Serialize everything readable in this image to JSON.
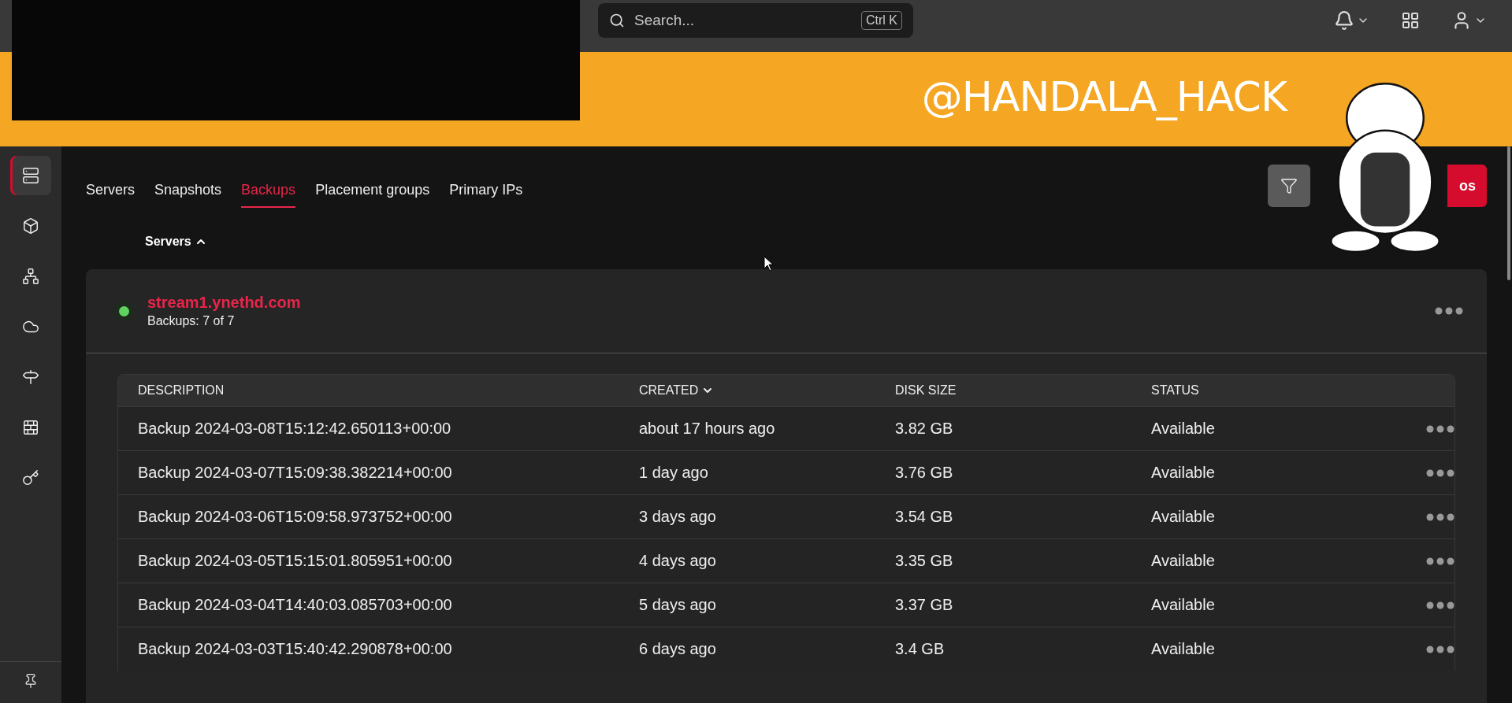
{
  "search": {
    "placeholder": "Search...",
    "shortcut": "Ctrl K"
  },
  "banner": {
    "text": "@HANDALA_HACK"
  },
  "sidebar": {
    "items": [
      {
        "selected": true
      },
      {
        "selected": false
      },
      {
        "selected": false
      },
      {
        "selected": false
      },
      {
        "selected": false
      },
      {
        "selected": false
      },
      {
        "selected": false
      }
    ]
  },
  "tabs": [
    {
      "label": "Servers",
      "selected": false
    },
    {
      "label": "Snapshots",
      "selected": false
    },
    {
      "label": "Backups",
      "selected": true
    },
    {
      "label": "Placement groups",
      "selected": false
    },
    {
      "label": "Primary IPs",
      "selected": false
    }
  ],
  "action_button": {
    "label": "os"
  },
  "group_sort": {
    "label": "Servers",
    "ascending": true
  },
  "server": {
    "name": "stream1.ynethd.com",
    "subtitle": "Backups: 7 of 7",
    "color": "#5fd35f"
  },
  "table": {
    "sort_ascending": false,
    "columns": [
      {
        "label": "DESCRIPTION",
        "sorted": false
      },
      {
        "label": "CREATED",
        "sorted": true
      },
      {
        "label": "DISK SIZE",
        "sorted": false
      },
      {
        "label": "STATUS",
        "sorted": false
      }
    ],
    "rows": [
      {
        "description": "Backup 2024-03-08T15:12:42.650113+00:00",
        "created": "about 17 hours ago",
        "disk_size": "3.82 GB",
        "status": "Available"
      },
      {
        "description": "Backup 2024-03-07T15:09:38.382214+00:00",
        "created": "1 day ago",
        "disk_size": "3.76 GB",
        "status": "Available"
      },
      {
        "description": "Backup 2024-03-06T15:09:58.973752+00:00",
        "created": "3 days ago",
        "disk_size": "3.54 GB",
        "status": "Available"
      },
      {
        "description": "Backup 2024-03-05T15:15:01.805951+00:00",
        "created": "4 days ago",
        "disk_size": "3.35 GB",
        "status": "Available"
      },
      {
        "description": "Backup 2024-03-04T14:40:03.085703+00:00",
        "created": "5 days ago",
        "disk_size": "3.37 GB",
        "status": "Available"
      },
      {
        "description": "Backup 2024-03-03T15:40:42.290878+00:00",
        "created": "6 days ago",
        "disk_size": "3.4 GB",
        "status": "Available"
      }
    ]
  }
}
